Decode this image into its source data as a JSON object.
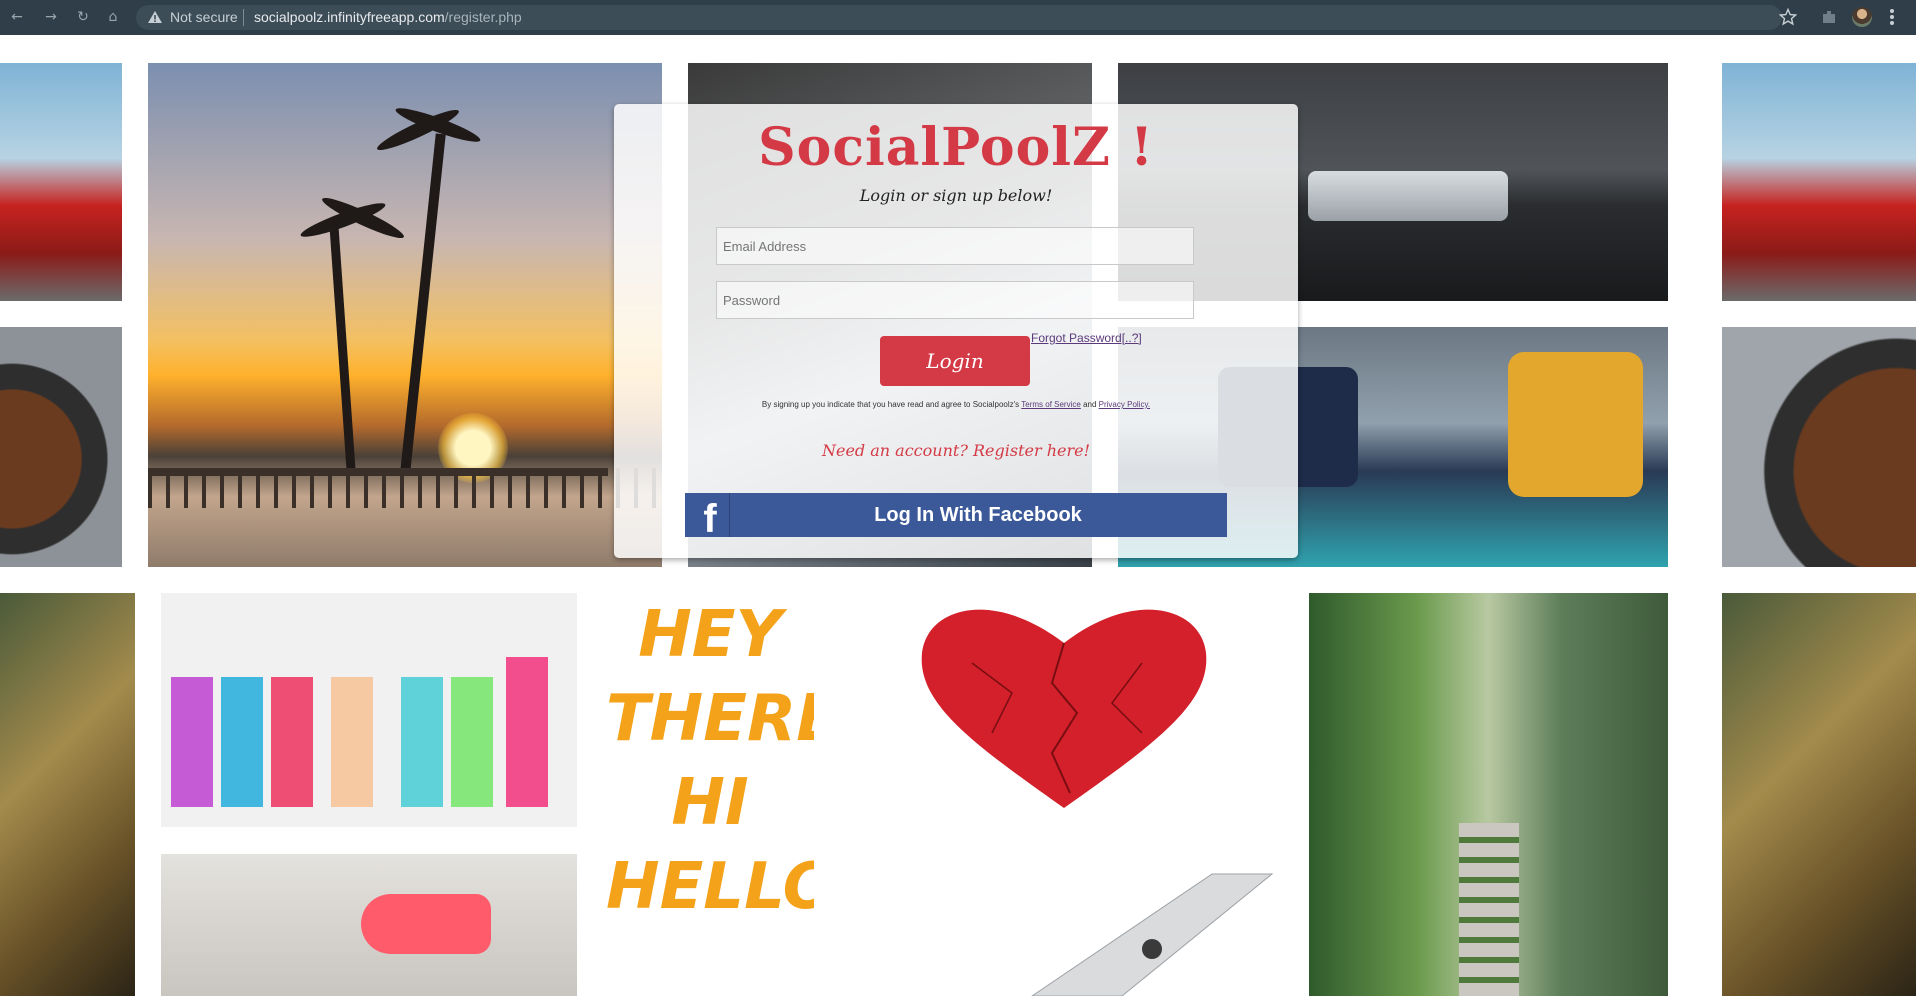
{
  "browser": {
    "security_label": "Not secure",
    "url_host": "socialpoolz.infinityfreeapp.com",
    "url_path": "/register.php"
  },
  "tiles": {
    "hey_lines": [
      "HEY",
      "THERE",
      "HI",
      "HELLO"
    ]
  },
  "login": {
    "logo": "SocialPoolZ !",
    "tagline": "Login or sign up below!",
    "email_placeholder": "Email Address",
    "password_placeholder": "Password",
    "login_button": "Login",
    "forgot_link": "Forgot Password[..?]",
    "terms_prefix": "By signing up you indicate that you have read and agree to Socialpoolz's",
    "terms_link": "Terms of Service",
    "terms_and": "and",
    "privacy_link": "Privacy Policy.",
    "register_link": "Need an account? Register here!",
    "facebook_button": "Log In With Facebook",
    "facebook_icon_glyph": "f"
  },
  "colors": {
    "brand_red": "#d43a46",
    "facebook_blue": "#3b5998",
    "link_purple": "#5a3a7a"
  }
}
